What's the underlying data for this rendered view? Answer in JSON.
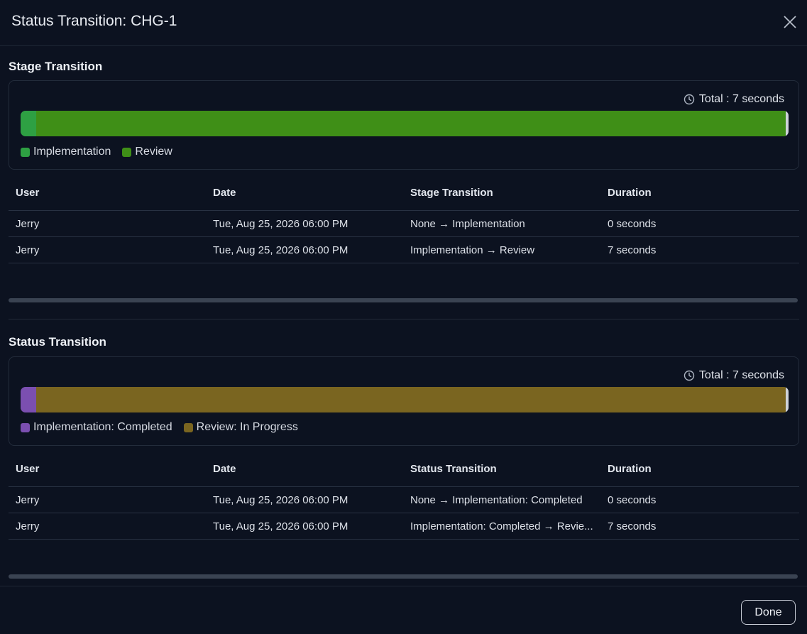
{
  "dialog": {
    "title": "Status Transition: CHG-1",
    "done_label": "Done"
  },
  "stage": {
    "heading": "Stage Transition",
    "total": "Total : 7 seconds",
    "bar": [
      {
        "label": "Implementation",
        "fraction": 0.02,
        "color": "#2ea043"
      },
      {
        "label": "Review",
        "fraction": 0.98,
        "color": "#3f8f17"
      }
    ],
    "columns": [
      "User",
      "Date",
      "Stage Transition",
      "Duration"
    ],
    "rows": [
      [
        "Jerry",
        "Tue, Aug 25, 2026 06:00 PM",
        "None → Implementation",
        "0 seconds"
      ],
      [
        "Jerry",
        "Tue, Aug 25, 2026 06:00 PM",
        "Implementation → Review",
        "7 seconds"
      ]
    ]
  },
  "status": {
    "heading": "Status Transition",
    "total": "Total : 7 seconds",
    "bar": [
      {
        "label": "Implementation: Completed",
        "fraction": 0.02,
        "color": "#7b4fb0"
      },
      {
        "label": "Review: In Progress",
        "fraction": 0.98,
        "color": "#7a6520"
      }
    ],
    "columns": [
      "User",
      "Date",
      "Status Transition",
      "Duration"
    ],
    "rows": [
      [
        "Jerry",
        "Tue, Aug 25, 2026 06:00 PM",
        "None → Implementation: Completed",
        "0 seconds"
      ],
      [
        "Jerry",
        "Tue, Aug 25, 2026 06:00 PM",
        "Implementation: Completed → Revie...",
        "7 seconds"
      ]
    ]
  },
  "icons": {
    "close": "close-icon",
    "clock": "clock-icon"
  }
}
